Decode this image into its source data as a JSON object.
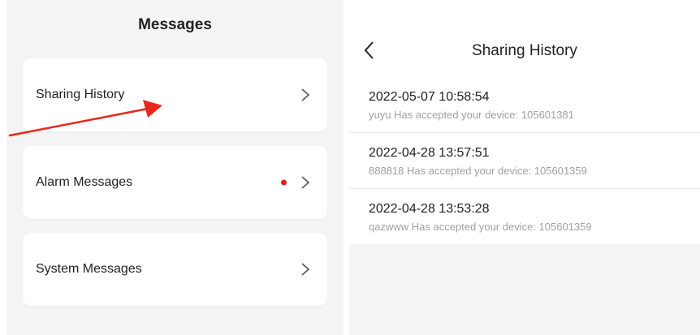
{
  "left": {
    "title": "Messages",
    "items": [
      {
        "label": "Sharing History",
        "has_badge": false
      },
      {
        "label": "Alarm Messages",
        "has_badge": true
      },
      {
        "label": "System Messages",
        "has_badge": false
      }
    ],
    "badge_color": "#e02020",
    "annotation_arrow_color": "#e8281e"
  },
  "right": {
    "nav_title": "Sharing History",
    "back_icon": "chevron-left-icon",
    "entries": [
      {
        "timestamp": "2022-05-07 10:58:54",
        "description": "yuyu Has accepted your device: 105601381"
      },
      {
        "timestamp": "2022-04-28 13:57:51",
        "description": "888818 Has accepted your device: 105601359"
      },
      {
        "timestamp": "2022-04-28 13:53:28",
        "description": "qazwww Has accepted your device: 105601359"
      }
    ]
  }
}
